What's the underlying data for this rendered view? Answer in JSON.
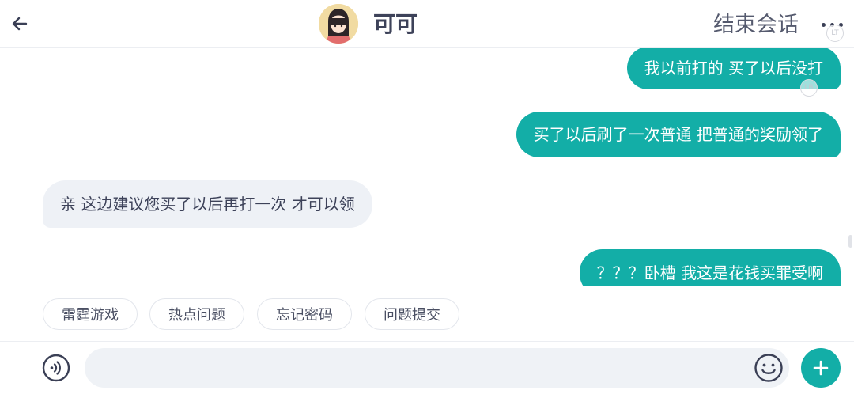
{
  "header": {
    "title": "可可",
    "end_label": "结束会话",
    "watermark_top": "LT"
  },
  "messages": [
    {
      "side": "me",
      "text": "我以前打的 买了以后没打"
    },
    {
      "side": "me",
      "text": "买了以后刷了一次普通 把普通的奖励领了"
    },
    {
      "side": "them",
      "text": "亲 这边建议您买了以后再打一次 才可以领"
    },
    {
      "side": "me",
      "text": "？？？卧槽 我这是花钱买罪受啊"
    }
  ],
  "watermark_bubble": "LB",
  "quick_replies": [
    "雷霆游戏",
    "热点问题",
    "忘记密码",
    "问题提交"
  ],
  "input": {
    "value": "",
    "placeholder": ""
  },
  "icons": {
    "back": "arrow-left-icon",
    "more": "more-dots-icon",
    "voice": "voice-icon",
    "emoji": "emoji-icon",
    "add": "plus-icon"
  },
  "colors": {
    "accent": "#13aea7",
    "incoming_bubble": "#eef1f6",
    "text": "#3d4259"
  }
}
